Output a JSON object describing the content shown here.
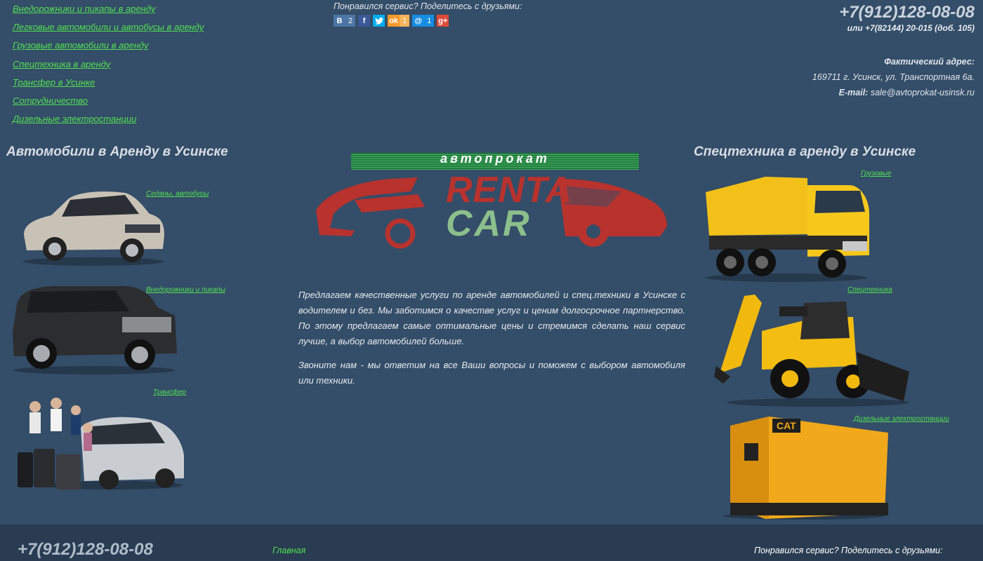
{
  "top_nav": [
    "Внедорожники и пикапы в аренду",
    "Легковые автомобили и автобусы в аренду",
    "Грузовые автомобили в аренду",
    "Спецтехника в аренду",
    "Трансфер в Усинке",
    "Сотрудничество",
    "Дизельные электростанции"
  ],
  "share": {
    "label": "Понравился сервис? Поделитесь с друзьями:",
    "buttons": [
      {
        "icon": "vk-icon",
        "glyph": "В",
        "count": "2",
        "color": "#4c75a3"
      },
      {
        "icon": "facebook-icon",
        "glyph": "f",
        "count": "",
        "color": "#3b5998"
      },
      {
        "icon": "twitter-icon",
        "glyph": "t",
        "count": "",
        "color": "#00aced"
      },
      {
        "icon": "odnoklassniki-icon",
        "glyph": "ok",
        "count": "1",
        "color": "#f59a2a"
      },
      {
        "icon": "mailru-icon",
        "glyph": "@",
        "count": "1",
        "color": "#168de2"
      },
      {
        "icon": "googleplus-icon",
        "glyph": "g+",
        "count": "",
        "color": "#dd4b39"
      }
    ]
  },
  "contacts": {
    "phone": "+7(912)128-08-08",
    "phone_alt": "или +7(82144) 20-015 (доб. 105)",
    "address_label": "Фактический адрес:",
    "address": "169711 г. Усинск, ул. Транспортная 6а.",
    "email_label": "E-mail:",
    "email": "sale@avtoprokat-usinsk.ru"
  },
  "left_section": {
    "title": "Автомобили в Аренду в Усинске",
    "links": [
      "Седаны, автобусы",
      "Внедорожники и пикапы",
      "Трансфер"
    ]
  },
  "right_section": {
    "title": "Спецтехника в аренду в Усинске",
    "links": [
      "Грузовые",
      "Спецтехника",
      "Дизельные электростанции"
    ]
  },
  "logo": {
    "top": "автопрокат",
    "word1": "RENTA",
    "word2": "CAR"
  },
  "intro": {
    "p1": "Предлагаем качественные услуги по аренде автомобилей и спец.техники в Усинске с водителем и без. Мы заботимся о качестве услуг и ценим долгосрочное партнерство. По этому предлагаем самые оптимальные цены и стремимся сделать наш сервис лучше, а выбор автомобилей больше.",
    "p2": "Звоните нам - мы ответим на все Ваши вопросы и поможем с выбором автомобиля или техники."
  },
  "footer": {
    "phone": "+7(912)128-08-08",
    "home_link": "Главная",
    "share_label": "Понравился сервис? Поделитесь с друзьями:"
  },
  "colors": {
    "background": "#344d68",
    "link": "#52e052",
    "footer": "#2a3c52"
  }
}
